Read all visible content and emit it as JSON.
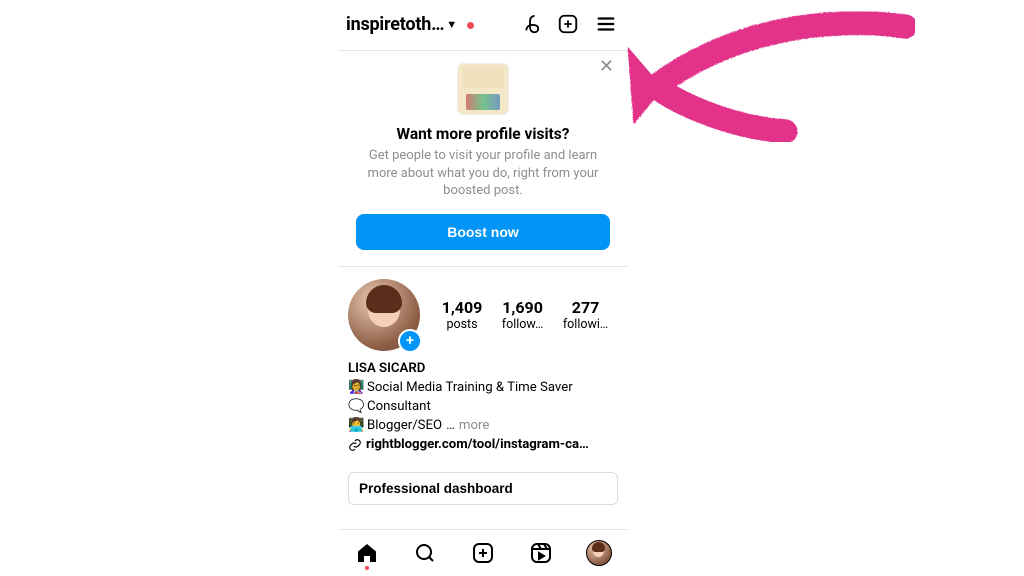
{
  "header": {
    "username_truncated": "inspiretoth…"
  },
  "promo": {
    "title": "Want more profile visits?",
    "body": "Get people to visit your profile and learn more about what you do, right from your boosted post.",
    "cta": "Boost now"
  },
  "stats": {
    "posts": {
      "count": "1,409",
      "label": "posts"
    },
    "followers": {
      "count": "1,690",
      "label": "follow…"
    },
    "following": {
      "count": "277",
      "label": "followi…"
    }
  },
  "bio": {
    "display_name": "LISA SICARD",
    "line1": "Social Media Training & Time Saver",
    "line2": "Consultant",
    "line3_prefix": "Blogger/SEO",
    "line3_ellipsis": "…",
    "more_label": "more",
    "link_text": "rightblogger.com/tool/instagram-ca…"
  },
  "dashboard": {
    "label": "Professional dashboard"
  },
  "icons": {
    "threads": "threads-icon",
    "new_post": "create-icon",
    "menu": "hamburger-icon",
    "close": "close-icon",
    "home": "home-icon",
    "search": "search-icon",
    "create": "create-icon",
    "reels": "reels-icon",
    "profile": "profile-avatar"
  },
  "colors": {
    "accent": "#0095f6",
    "notification": "#ed4956",
    "annotation": "#e2308a"
  }
}
